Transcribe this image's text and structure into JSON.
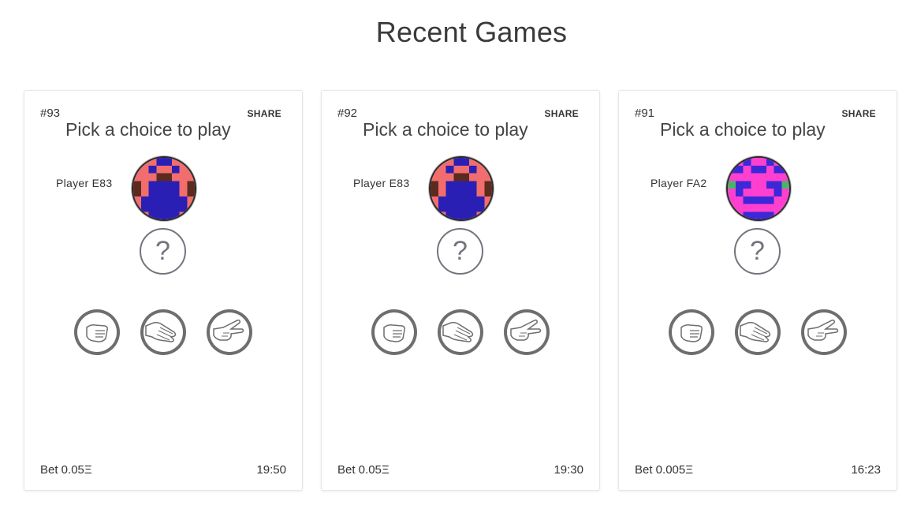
{
  "page": {
    "title": "Recent Games"
  },
  "colors": {
    "avatar_e83": {
      "bg": "#f26d6d",
      "fg": "#2a1fb5",
      "accent": "#5a2b1e"
    },
    "avatar_fa2": {
      "bg": "#ff3fd0",
      "fg": "#3b28d8",
      "accent": "#4bb368"
    },
    "choice_ring": "#6e6e6e",
    "mystery": "#74747f"
  },
  "games": [
    {
      "id": "#93",
      "share_label": "SHARE",
      "prompt": "Pick a choice to play",
      "player": "Player E83",
      "mystery_symbol": "?",
      "choices": [
        "rock",
        "paper",
        "scissors"
      ],
      "bet": "Bet 0.05Ξ",
      "time": "19:50"
    },
    {
      "id": "#92",
      "share_label": "SHARE",
      "prompt": "Pick a choice to play",
      "player": "Player E83",
      "mystery_symbol": "?",
      "choices": [
        "rock",
        "paper",
        "scissors"
      ],
      "bet": "Bet 0.05Ξ",
      "time": "19:30"
    },
    {
      "id": "#91",
      "share_label": "SHARE",
      "prompt": "Pick a choice to play",
      "player": "Player FA2",
      "mystery_symbol": "?",
      "choices": [
        "rock",
        "paper",
        "scissors"
      ],
      "bet": "Bet 0.005Ξ",
      "time": "16:23"
    }
  ]
}
